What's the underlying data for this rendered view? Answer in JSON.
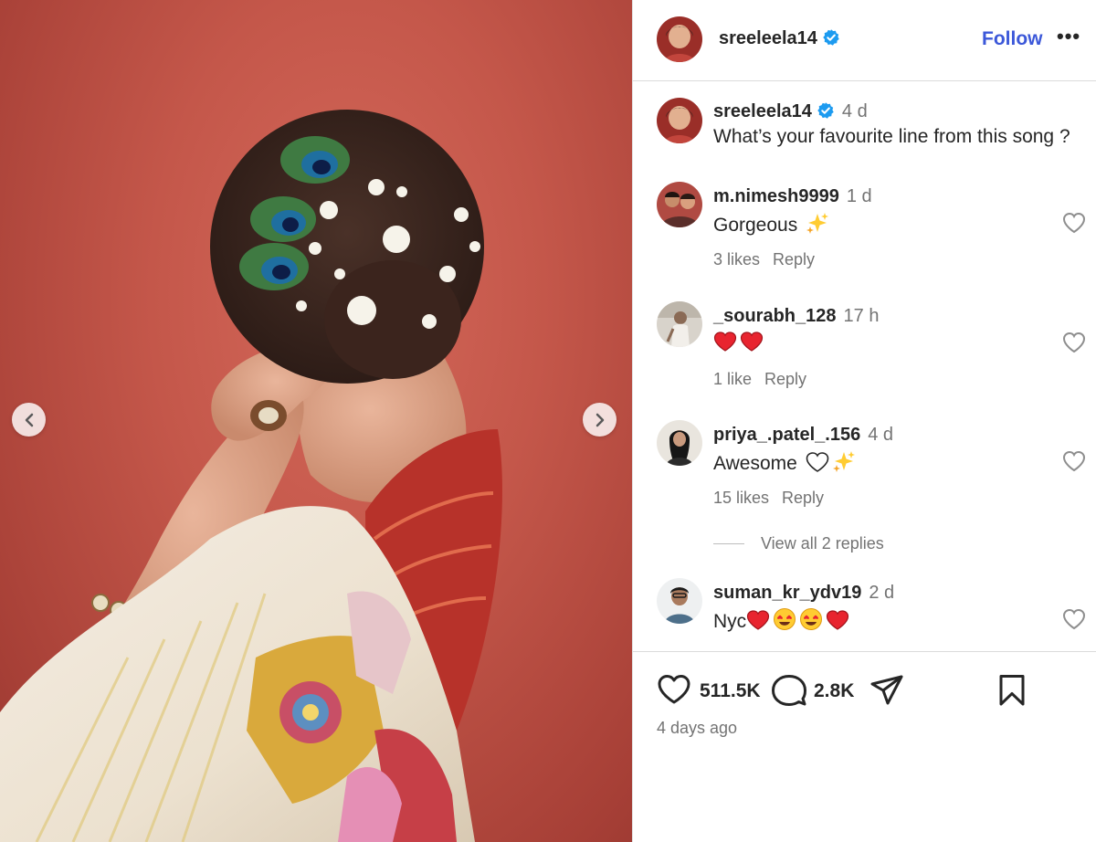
{
  "post": {
    "username": "sreeleela14",
    "follow_label": "Follow",
    "more_label": "•••",
    "caption": {
      "username": "sreeleela14",
      "time": "4 d",
      "text": "What’s your favourite line from this song ?"
    }
  },
  "comments": [
    {
      "username": "m.nimesh9999",
      "time": "1 d",
      "text": "Gorgeous",
      "emojis": [
        "sparkles"
      ],
      "likes": "3 likes",
      "reply_label": "Reply"
    },
    {
      "username": "_sourabh_128",
      "time": "17 h",
      "text": "",
      "emojis": [
        "red-heart",
        "red-heart"
      ],
      "likes": "1 like",
      "reply_label": "Reply"
    },
    {
      "username": "priya_.patel_.156",
      "time": "4 d",
      "text": "Awesome",
      "emojis": [
        "white-heart",
        "sparkles"
      ],
      "likes": "15 likes",
      "reply_label": "Reply"
    },
    {
      "username": "suman_kr_ydv19",
      "time": "2 d",
      "text": "Nyc",
      "emojis": [
        "red-heart",
        "heart-eyes",
        "heart-eyes",
        "red-heart"
      ],
      "likes": "",
      "reply_label": ""
    }
  ],
  "view_replies_label": "View all 2 replies",
  "stats": {
    "likes": "511.5K",
    "comments": "2.8K",
    "posted": "4 days ago"
  },
  "colors": {
    "follow": "#3c58d9",
    "verified": "#1d9bf0",
    "backdrop": "#c4574a"
  }
}
